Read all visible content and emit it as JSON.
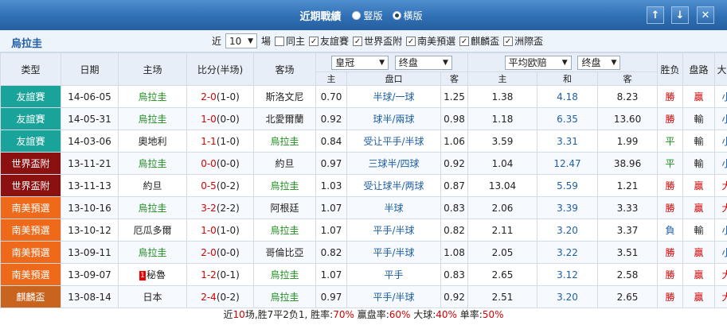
{
  "header": {
    "title": "近期戰績",
    "radio_a": "豎版",
    "radio_b": "橫版",
    "btn_up": "↑",
    "btn_down": "↓",
    "btn_close": "✕"
  },
  "subhead": {
    "team": "烏拉圭",
    "recent_label": "近",
    "recent_value": "10",
    "games_label": "場",
    "checks": [
      "同主",
      "友誼賽",
      "世界盃附",
      "南美預選",
      "麒麟盃",
      "洲際盃"
    ]
  },
  "columns": {
    "type": "类型",
    "date": "日期",
    "home": "主场",
    "score": "比分(半场)",
    "away": "客场",
    "company": "皇冠",
    "asian_sel": "终盘",
    "euro_sel": "平均欧赔",
    "euro_sub": "终盘",
    "result": "胜负",
    "handicap": "盘路",
    "ou": "大小",
    "sub_home": "主",
    "sub_line": "盘口",
    "sub_away": "客",
    "sub_e_home": "主",
    "sub_e_draw": "和",
    "sub_e_away": "客"
  },
  "colors": {
    "friendly": "#1aa39a",
    "wcq": "#8b1010",
    "samq": "#ee6a1a",
    "kirin": "#c8641e"
  },
  "rows": [
    {
      "type": "友誼賽",
      "color": "#1aa39a",
      "date": "14-06-05",
      "home": "烏拉圭",
      "home_green": true,
      "score": "2-0",
      "half": "(1-0)",
      "away": "斯洛文尼",
      "away_green": false,
      "ah": "0.70",
      "line": "半球/一球",
      "aa": "1.25",
      "eh": "1.38",
      "ed": "4.18",
      "ea": "8.23",
      "res": "勝",
      "hc": "贏",
      "ou": "小"
    },
    {
      "type": "友誼賽",
      "color": "#1aa39a",
      "date": "14-05-31",
      "home": "烏拉圭",
      "home_green": true,
      "score": "1-0",
      "half": "(0-0)",
      "away": "北愛爾蘭",
      "away_green": false,
      "ah": "0.92",
      "line": "球半/兩球",
      "aa": "0.98",
      "eh": "1.18",
      "ed": "6.35",
      "ea": "13.60",
      "res": "勝",
      "hc": "輸",
      "ou": "小"
    },
    {
      "type": "友誼賽",
      "color": "#1aa39a",
      "date": "14-03-06",
      "home": "奧地利",
      "home_green": false,
      "score": "1-1",
      "half": "(1-0)",
      "away": "烏拉圭",
      "away_green": true,
      "ah": "0.84",
      "line": "受让平手/半球",
      "aa": "1.06",
      "eh": "3.59",
      "ed": "3.31",
      "ea": "1.99",
      "res": "平",
      "hc": "輸",
      "ou": "小"
    },
    {
      "type": "世界盃附",
      "color": "#8b1010",
      "date": "13-11-21",
      "home": "烏拉圭",
      "home_green": true,
      "score": "0-0",
      "half": "(0-0)",
      "away": "約旦",
      "away_green": false,
      "ah": "0.97",
      "line": "三球半/四球",
      "aa": "0.92",
      "eh": "1.04",
      "ed": "12.47",
      "ea": "38.96",
      "res": "平",
      "hc": "輸",
      "ou": "小"
    },
    {
      "type": "世界盃附",
      "color": "#8b1010",
      "date": "13-11-13",
      "home": "約旦",
      "home_green": false,
      "score": "0-5",
      "half": "(0-2)",
      "away": "烏拉圭",
      "away_green": true,
      "ah": "1.03",
      "line": "受让球半/两球",
      "aa": "0.87",
      "eh": "13.04",
      "ed": "5.59",
      "ea": "1.21",
      "res": "勝",
      "hc": "贏",
      "ou": "大"
    },
    {
      "type": "南美預選",
      "color": "#ee6a1a",
      "date": "13-10-16",
      "home": "烏拉圭",
      "home_green": true,
      "score": "3-2",
      "half": "(2-2)",
      "away": "阿根廷",
      "away_green": false,
      "ah": "1.07",
      "line": "半球",
      "aa": "0.83",
      "eh": "2.06",
      "ed": "3.39",
      "ea": "3.33",
      "res": "勝",
      "hc": "贏",
      "ou": "大"
    },
    {
      "type": "南美預選",
      "color": "#ee6a1a",
      "date": "13-10-12",
      "home": "厄瓜多爾",
      "home_green": false,
      "score": "1-0",
      "half": "(1-0)",
      "away": "烏拉圭",
      "away_green": true,
      "ah": "1.07",
      "line": "平手/半球",
      "aa": "0.82",
      "eh": "2.11",
      "ed": "3.20",
      "ea": "3.37",
      "res": "負",
      "hc": "輸",
      "ou": "小"
    },
    {
      "type": "南美預選",
      "color": "#ee6a1a",
      "date": "13-09-11",
      "home": "烏拉圭",
      "home_green": true,
      "score": "2-0",
      "half": "(0-0)",
      "away": "哥倫比亞",
      "away_green": false,
      "ah": "0.82",
      "line": "平手/半球",
      "aa": "1.08",
      "eh": "2.05",
      "ed": "3.22",
      "ea": "3.51",
      "res": "勝",
      "hc": "贏",
      "ou": "小"
    },
    {
      "type": "南美預選",
      "color": "#ee6a1a",
      "date": "13-09-07",
      "home": "秘魯",
      "home_green": false,
      "home_rank": "1",
      "score": "1-2",
      "half": "(0-1)",
      "away": "烏拉圭",
      "away_green": true,
      "ah": "1.07",
      "line": "平手",
      "aa": "0.83",
      "eh": "2.65",
      "ed": "3.12",
      "ea": "2.58",
      "res": "勝",
      "hc": "贏",
      "ou": "大"
    },
    {
      "type": "麒麟盃",
      "color": "#c8641e",
      "date": "13-08-14",
      "home": "日本",
      "home_green": false,
      "score": "2-4",
      "half": "(0-2)",
      "away": "烏拉圭",
      "away_green": true,
      "ah": "0.97",
      "line": "平手/半球",
      "aa": "0.92",
      "eh": "2.51",
      "ed": "3.20",
      "ea": "2.65",
      "res": "勝",
      "hc": "贏",
      "ou": "大"
    }
  ],
  "summary": {
    "p1": "近",
    "games": "10",
    "p2": "场,胜7平2负1, 胜率:",
    "win_rate": "70%",
    "p3": " 赢盘率:",
    "cover_rate": "60%",
    "p4": " 大球:",
    "over_rate": "40%",
    "p5": " 单率:",
    "odd_rate": "50%"
  }
}
